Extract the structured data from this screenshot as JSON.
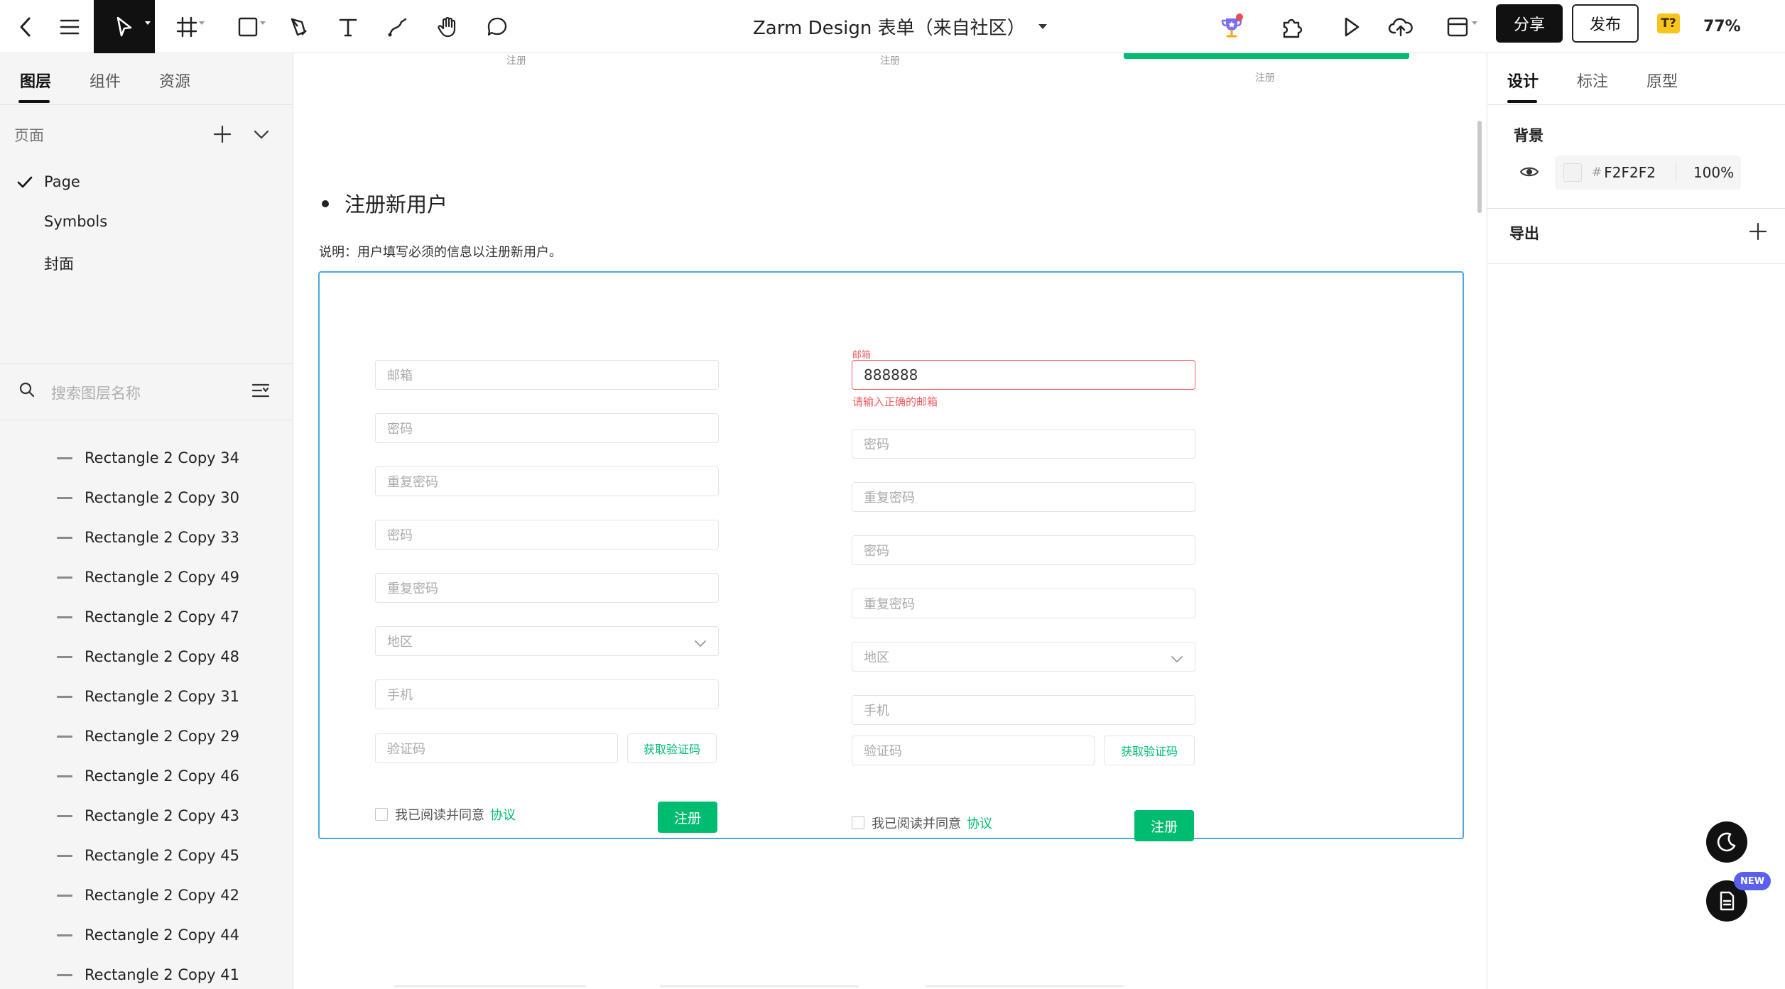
{
  "toolbar": {
    "doc_title": "Zarm Design 表单（来自社区）",
    "share_label": "分享",
    "publish_label": "发布",
    "badge_text": "T?",
    "zoom": "77%"
  },
  "left_panel": {
    "tabs": [
      "图层",
      "组件",
      "资源"
    ],
    "pages_label": "页面",
    "pages": [
      "Page",
      "Symbols",
      "封面"
    ],
    "search_placeholder": "搜索图层名称",
    "layers": [
      "Rectangle 2 Copy 34",
      "Rectangle 2 Copy 30",
      "Rectangle 2 Copy 33",
      "Rectangle 2 Copy 49",
      "Rectangle 2 Copy 47",
      "Rectangle 2 Copy 48",
      "Rectangle 2 Copy 31",
      "Rectangle 2 Copy 29",
      "Rectangle 2 Copy 46",
      "Rectangle 2 Copy 43",
      "Rectangle 2 Copy 45",
      "Rectangle 2 Copy 42",
      "Rectangle 2 Copy 44",
      "Rectangle 2 Copy 41"
    ]
  },
  "canvas": {
    "top_labels": [
      "注册",
      "注册",
      "注册"
    ],
    "section_title": "注册新用户",
    "description": "说明：用户填写必须的信息以注册新用户。",
    "form_left": {
      "fields": [
        "邮箱",
        "密码",
        "重复密码",
        "密码",
        "重复密码",
        "地区",
        "手机"
      ],
      "code_placeholder": "验证码",
      "code_button": "获取验证码",
      "agree_text": "我已阅读并同意",
      "agree_link": "协议",
      "submit": "注册"
    },
    "form_right": {
      "email_label": "邮箱",
      "email_value": "888888",
      "email_error": "请输入正确的邮箱",
      "fields": [
        "密码",
        "重复密码",
        "密码",
        "重复密码",
        "地区",
        "手机"
      ],
      "code_placeholder": "验证码",
      "code_button": "获取验证码",
      "agree_text": "我已阅读并同意",
      "agree_link": "协议",
      "submit": "注册"
    }
  },
  "right_panel": {
    "tabs": [
      "设计",
      "标注",
      "原型"
    ],
    "background_label": "背景",
    "color_hash": "#",
    "color_hex": "F2F2F2",
    "opacity": "100%",
    "export_label": "导出"
  },
  "floating": {
    "new_tag": "NEW"
  },
  "colors": {
    "accent_green": "#00bc70",
    "error_red": "#f15e63",
    "frame_blue": "#4aa8e0",
    "canvas_bg": "#F2F2F2"
  }
}
